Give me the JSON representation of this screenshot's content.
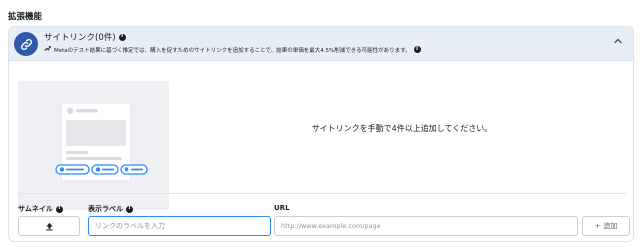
{
  "section": {
    "title": "拡張機能"
  },
  "sitelinks": {
    "title": "サイトリンク(0件)",
    "subtitle": "Metaのテスト結果に基づく推定では、購入を促すためのサイトリンクを追加することで、結果の単価を最大4.5%削減できる可能性があります。",
    "empty_message": "サイトリンクを手動で4件以上追加してください。"
  },
  "form": {
    "thumbnail_label": "サムネイル",
    "display_label_label": "表示ラベル",
    "display_label_placeholder": "リンクのラベルを入力",
    "url_label": "URL",
    "url_placeholder": "http://www.example.com/page",
    "add_button": "追加"
  },
  "colors": {
    "accent": "#2f5aa8",
    "header_bg": "#e8eef7",
    "focus_border": "#2d88ff",
    "preview_bg": "#eef0f3"
  }
}
